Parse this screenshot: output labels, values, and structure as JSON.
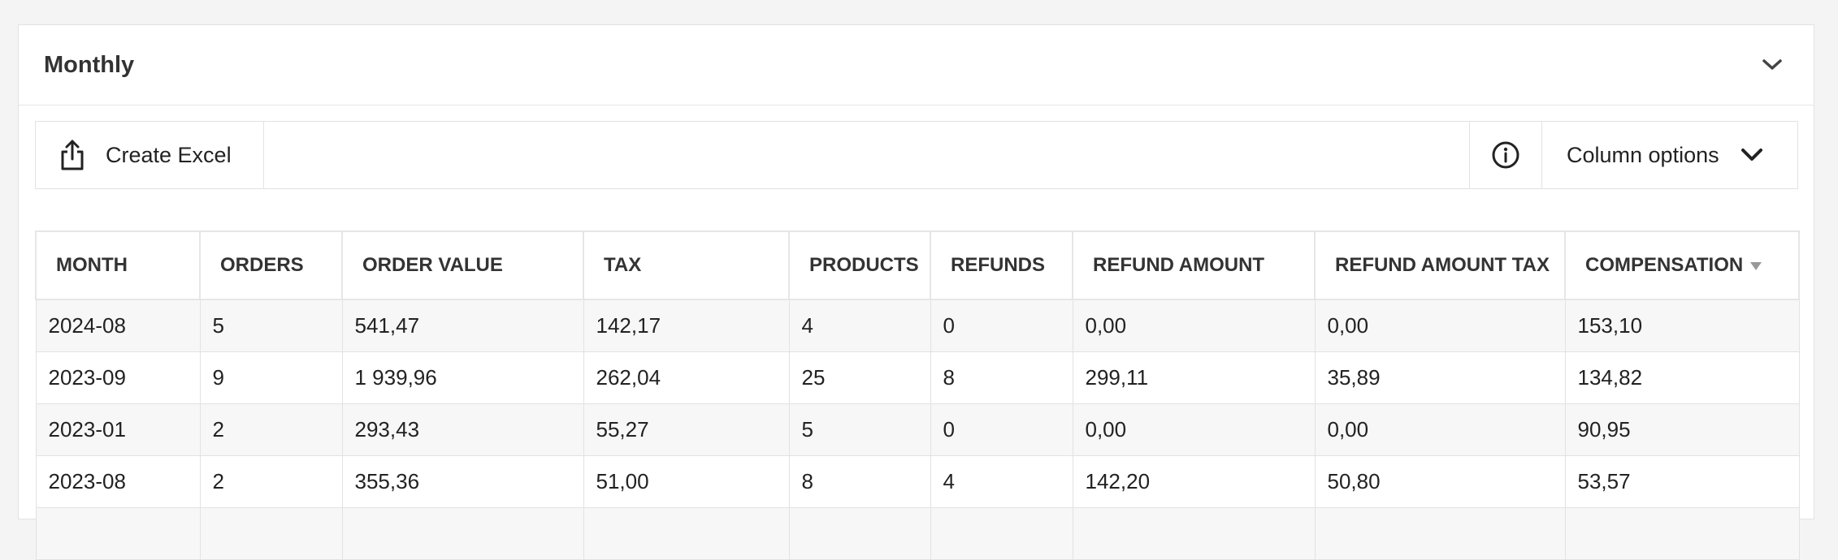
{
  "panel": {
    "title": "Monthly"
  },
  "toolbar": {
    "create_excel_label": "Create Excel",
    "column_options_label": "Column options"
  },
  "table": {
    "headers": [
      "MONTH",
      "ORDERS",
      "ORDER VALUE",
      "TAX",
      "PRODUCTS",
      "REFUNDS",
      "REFUND AMOUNT",
      "REFUND AMOUNT TAX",
      "COMPENSATION"
    ],
    "sorted_column": "COMPENSATION",
    "sort_direction": "descending",
    "rows": [
      [
        "2024-08",
        "5",
        "541,47",
        "142,17",
        "4",
        "0",
        "0,00",
        "0,00",
        "153,10"
      ],
      [
        "2023-09",
        "9",
        "1 939,96",
        "262,04",
        "25",
        "8",
        "299,11",
        "35,89",
        "134,82"
      ],
      [
        "2023-01",
        "2",
        "293,43",
        "55,27",
        "5",
        "0",
        "0,00",
        "0,00",
        "90,95"
      ],
      [
        "2023-08",
        "2",
        "355,36",
        "51,00",
        "8",
        "4",
        "142,20",
        "50,80",
        "53,57"
      ],
      [
        "",
        "",
        "",
        "",
        "",
        "",
        "",
        "",
        ""
      ]
    ]
  },
  "colors": {
    "background": "#f4f4f4",
    "panel": "#ffffff",
    "border": "#e2e2e2",
    "stripe": "#f7f7f7",
    "text": "#222222"
  }
}
